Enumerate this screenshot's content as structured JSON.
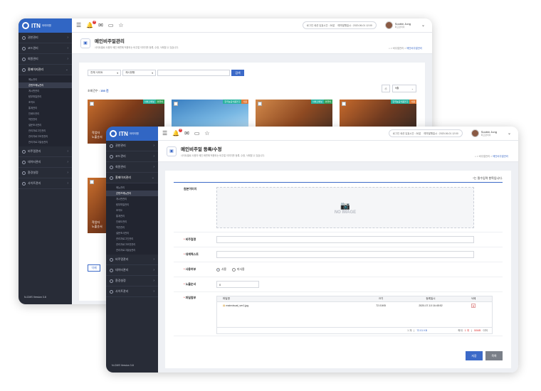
{
  "brand": {
    "name": "ITN",
    "sub": "아이티엔",
    "tagline": "IDEA TECHNOLOGY NETWORK"
  },
  "topbar": {
    "session": "로그인 세션 유효시간 : 30분",
    "reserve": "예약발행일시 : 2020-06-01 12:00",
    "reserve2": "예약발행일시 : 2020-06-01 12:00",
    "user_name": "Soobin Jung",
    "user_role": "최고관리자",
    "badge_count": "8"
  },
  "sidebar": {
    "items": [
      {
        "label": "권한관리"
      },
      {
        "label": "코드관리"
      },
      {
        "label": "회원관리"
      },
      {
        "label": "홈페이지관리"
      }
    ],
    "sub_items": [
      "메뉴관리",
      "콘텐츠메뉴관리",
      "게시판관리",
      "탐부파일관리",
      "조직도",
      "통계관리",
      "인쇄도관리",
      "약관관리",
      "설문조사관리",
      "관리자로그인관리",
      "관리자로그보관관리",
      "관리자로그발송관리"
    ],
    "bottom_items": [
      {
        "label": "비주얼관리"
      },
      {
        "label": "데이터관리"
      },
      {
        "label": "환경설정"
      },
      {
        "label": "사이트관리"
      }
    ],
    "version": "N-CMS Version 3.8"
  },
  "list_page": {
    "title": "메인비주얼관리",
    "desc": "사이트별로 사용자 메인 화면에 적용되는 비주얼 이미지를 등록, 수정, 삭제할 수 있습니다.",
    "crumb_mid": "비주얼관리",
    "crumb_cur": "메인비주얼관리",
    "filter_site": "전체 사이트",
    "filter_field": "게시현행",
    "search_button": "검색",
    "total_label": "조회건수 :",
    "total_value": "158 건",
    "page_size": "9줄",
    "delete_button": "삭제",
    "thumbs": [
      {
        "tag1": "서비스채널",
        "tag2": "외국어",
        "cap1": "작업자",
        "cap2": "노출순서"
      },
      {
        "tag1": "한국농공식품연구",
        "tag2": "사용",
        "cap1": "",
        "cap2": ""
      },
      {
        "tag1": "서비스채널",
        "tag2": "외국어",
        "cap1": "",
        "cap2": ""
      },
      {
        "tag1": "한국농공식품연구",
        "tag2": "사용",
        "cap1": "",
        "cap2": ""
      },
      {
        "tag1": "",
        "tag2": "",
        "cap1": "작업자",
        "cap2": "노출순서"
      }
    ]
  },
  "form_page": {
    "title": "메인비주얼 등록/수정",
    "desc": "사이트별로 사용자 메인 화면에 적용되는 비주얼 이미지를 등록, 수정, 삭제할 수 있습니다.",
    "crumb_mid": "비주얼관리",
    "crumb_cur": "메인비주얼관리",
    "required_note": "*는 필수입력 항목입니다.",
    "original_image_label": "원본이미지",
    "no_image": "NO IMAGE",
    "visual_name_label": "비주얼명",
    "alt_text_label": "대체텍스트",
    "use_label": "사용여부",
    "use_yes": "사용",
    "use_no": "미사용",
    "order_label": "노출순서",
    "order_value": "0",
    "file_label": "파일첨부",
    "file_table": {
      "headers": [
        "파일명",
        "크기",
        "등록일시",
        "삭제"
      ],
      "rows": [
        {
          "name": "mainvisual_ver1.jpg",
          "size": "72.01KB",
          "date": "2020-07-10 16:45:52"
        }
      ],
      "count": "1 개",
      "total_size": "72.01 KB",
      "limit_prefix": "최대",
      "limit_count": "1 개",
      "limit_size": "50MB",
      "limit_suffix": "이하"
    },
    "save_button": "저장",
    "list_button": "목록"
  }
}
